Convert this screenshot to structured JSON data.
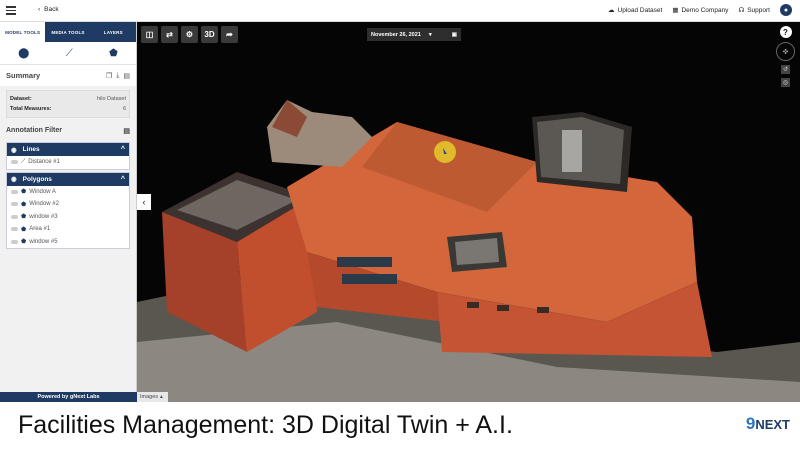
{
  "topbar": {
    "back_label": "Back",
    "upload_label": "Upload Dataset",
    "company_label": "Demo Company",
    "support_label": "Support"
  },
  "sidebar": {
    "tabs": [
      "MODEL TOOLS",
      "MEDIA TOOLS",
      "LAYERS"
    ],
    "summary_title": "Summary",
    "stats": [
      {
        "label": "Dataset:",
        "value": "hilo Dataset"
      },
      {
        "label": "Total Measures:",
        "value": "6"
      }
    ],
    "annotation_filter_label": "Annotation Filter",
    "groups": {
      "lines": {
        "label": "Lines",
        "items": [
          "Distance #1"
        ]
      },
      "polygons": {
        "label": "Polygons",
        "items": [
          "Window A",
          "Window #2",
          "window #3",
          "Area #1",
          "window #5"
        ]
      }
    },
    "powered_by": "Powered by gNext Labs"
  },
  "viewport": {
    "toolbar": {
      "btn_3d": "3D"
    },
    "date": "November 26, 2021",
    "help": "?",
    "images_label": "Images"
  },
  "caption": {
    "text": "Facilities Management: 3D Digital Twin + A.I.",
    "brand_prefix": "9",
    "brand_rest": "NEXT"
  },
  "colors": {
    "primary": "#1f3b63",
    "roof": "#d3663a",
    "wall": "#b8492a"
  }
}
